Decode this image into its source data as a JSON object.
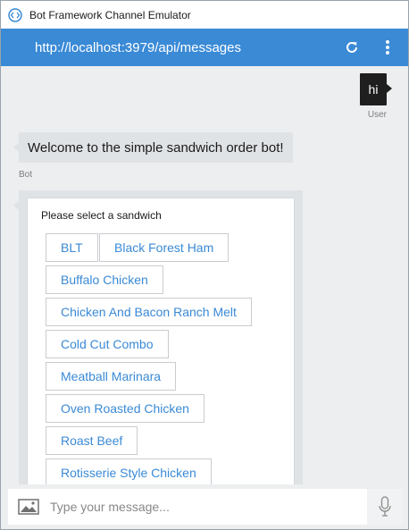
{
  "window": {
    "title": "Bot Framework Channel Emulator",
    "app_icon": "emulator-logo-icon"
  },
  "header": {
    "url": "http://localhost:3979/api/messages",
    "refresh_icon": "refresh-icon",
    "more_icon": "more-vertical-icon",
    "background": "#3a8ad6"
  },
  "conversation": {
    "user_message": "hi",
    "user_label": "User",
    "bot_message": "Welcome to the simple sandwich order bot!",
    "bot_label": "Bot"
  },
  "card": {
    "title": "Please select a sandwich",
    "options": [
      "BLT",
      "Black Forest Ham",
      "Buffalo Chicken",
      "Chicken And Bacon Ranch Melt",
      "Cold Cut Combo",
      "Meatball Marinara",
      "Oven Roasted Chicken",
      "Roast Beef",
      "Rotisserie Style Chicken"
    ]
  },
  "input": {
    "placeholder": "Type your message...",
    "image_icon": "image-icon",
    "mic_icon": "microphone-icon"
  },
  "colors": {
    "accent": "#3a8ad6",
    "chat_background": "#eceeef",
    "user_bubble": "#1f1f1f",
    "bot_bubble": "#e0e3e6"
  }
}
